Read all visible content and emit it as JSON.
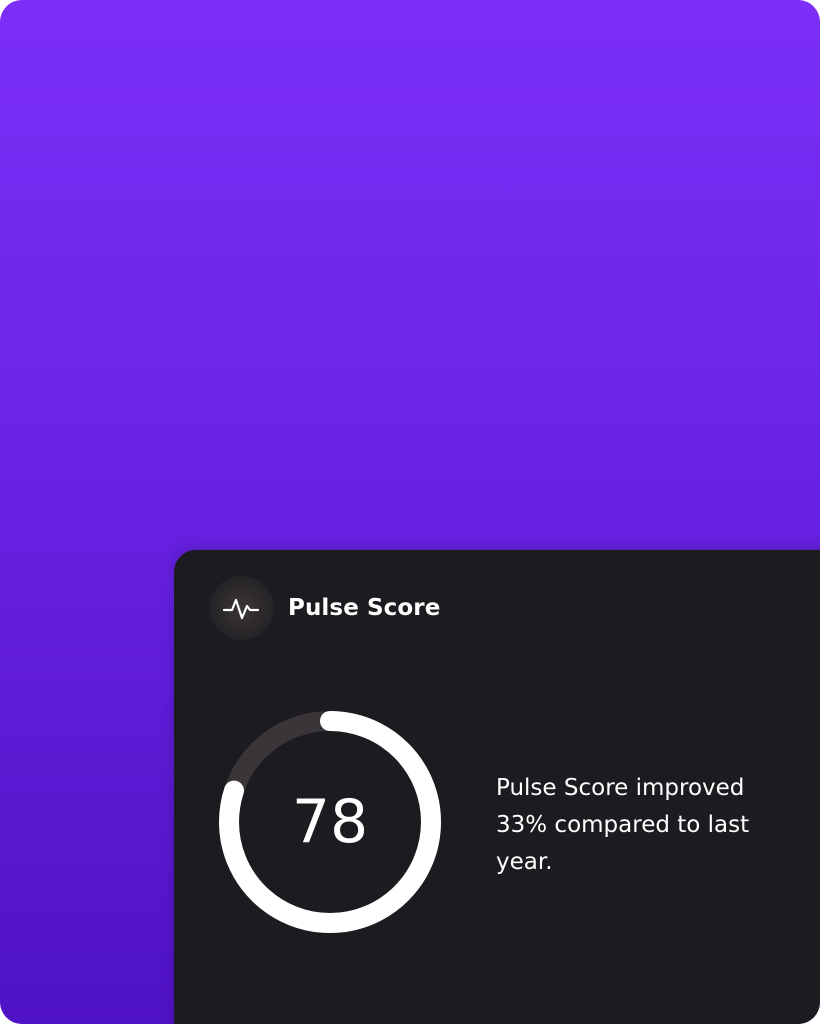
{
  "card": {
    "title": "Pulse Score",
    "icon": "pulse-icon",
    "score": "78",
    "score_fraction": 0.8,
    "description": "Pulse Score improved 33% compared to last year."
  },
  "colors": {
    "background_top": "#7b2ff7",
    "background_bottom": "#4f12c4",
    "card": "#1c1b1f",
    "ring_progress": "#ffffff",
    "ring_track": "#3a3538",
    "text": "#ffffff"
  }
}
